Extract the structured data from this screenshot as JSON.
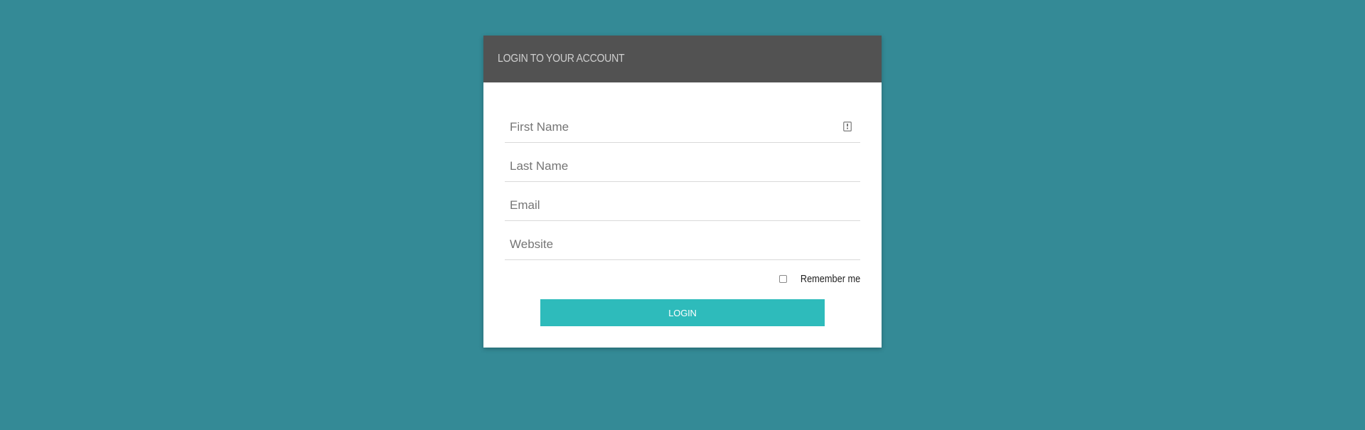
{
  "header": {
    "title": "LOGIN TO YOUR ACCOUNT"
  },
  "form": {
    "fields": [
      {
        "placeholder": "First Name",
        "value": ""
      },
      {
        "placeholder": "Last Name",
        "value": ""
      },
      {
        "placeholder": "Email",
        "value": ""
      },
      {
        "placeholder": "Website",
        "value": ""
      }
    ],
    "first_name_icon": "contact-card-icon",
    "remember_label": "Remember me",
    "remember_checked": false,
    "login_label": "LOGIN"
  },
  "colors": {
    "background": "#348a96",
    "header": "#525252",
    "button": "#2ebbbb"
  }
}
